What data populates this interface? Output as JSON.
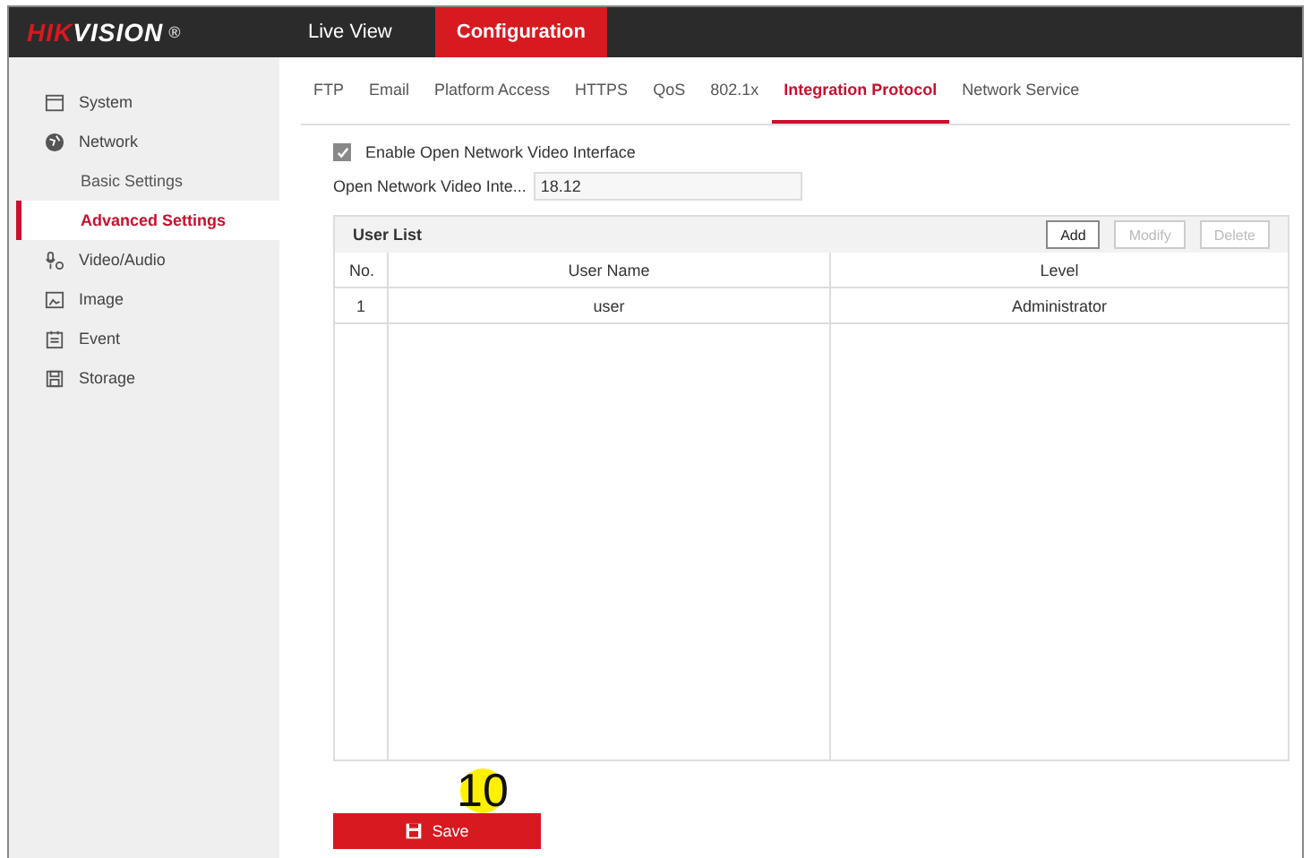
{
  "logo": {
    "accent": "HIK",
    "rest": "VISION",
    "mark": "®"
  },
  "top_tabs": [
    {
      "label": "Live View",
      "selected": false
    },
    {
      "label": "Configuration",
      "selected": true
    }
  ],
  "sidebar": {
    "items": [
      {
        "label": "System",
        "selected": false
      },
      {
        "label": "Network",
        "selected": false,
        "children": [
          {
            "label": "Basic Settings",
            "selected": false
          },
          {
            "label": "Advanced Settings",
            "selected": true
          }
        ]
      },
      {
        "label": "Video/Audio",
        "selected": false
      },
      {
        "label": "Image",
        "selected": false
      },
      {
        "label": "Event",
        "selected": false
      },
      {
        "label": "Storage",
        "selected": false
      }
    ]
  },
  "sub_tabs": [
    {
      "label": "FTP",
      "selected": false
    },
    {
      "label": "Email",
      "selected": false
    },
    {
      "label": "Platform Access",
      "selected": false
    },
    {
      "label": "HTTPS",
      "selected": false
    },
    {
      "label": "QoS",
      "selected": false
    },
    {
      "label": "802.1x",
      "selected": false
    },
    {
      "label": "Integration Protocol",
      "selected": true
    },
    {
      "label": "Network Service",
      "selected": false
    }
  ],
  "enable_checkbox": {
    "label": "Enable Open Network Video Interface",
    "checked": true
  },
  "version_field": {
    "label": "Open Network Video Inte...",
    "value": "18.12"
  },
  "user_list": {
    "title": "User List",
    "buttons": [
      {
        "label": "Add",
        "disabled": false
      },
      {
        "label": "Modify",
        "disabled": true
      },
      {
        "label": "Delete",
        "disabled": true
      }
    ],
    "columns": [
      "No.",
      "User Name",
      "Level"
    ],
    "rows": [
      [
        "1",
        "user",
        "Administrator"
      ]
    ]
  },
  "step_marker": "10",
  "save_button": "Save"
}
